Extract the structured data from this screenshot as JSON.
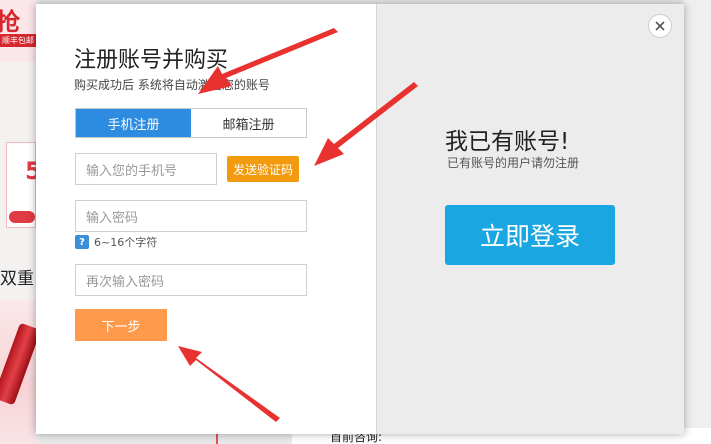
{
  "background": {
    "promo_text": "抢",
    "promo_sub": "顺丰包邮",
    "coupon_digit": "5",
    "double_text": "双重",
    "bottom_text": "首前咨询:"
  },
  "modal": {
    "title": "注册账号并购买",
    "subtitle": "购买成功后 系统将自动激活您的账号",
    "tabs": [
      {
        "label": "手机注册",
        "active": true
      },
      {
        "label": "邮箱注册",
        "active": false
      }
    ],
    "phone_placeholder": "输入您的手机号",
    "sms_button": "发送验证码",
    "password_placeholder": "输入密码",
    "password_hint": "6~16个字符",
    "hint_icon": "question-icon",
    "confirm_placeholder": "再次输入密码",
    "next_button": "下一步",
    "have_account_title": "我已有账号!",
    "have_account_sub": "已有账号的用户请勿注册",
    "login_button": "立即登录",
    "close_icon": "close-icon"
  },
  "colors": {
    "tab_active": "#2e8ce0",
    "sms_button": "#f39b0f",
    "next_button": "#ff9a4d",
    "login_button": "#1aa6e0",
    "arrow": "#e8322f"
  }
}
